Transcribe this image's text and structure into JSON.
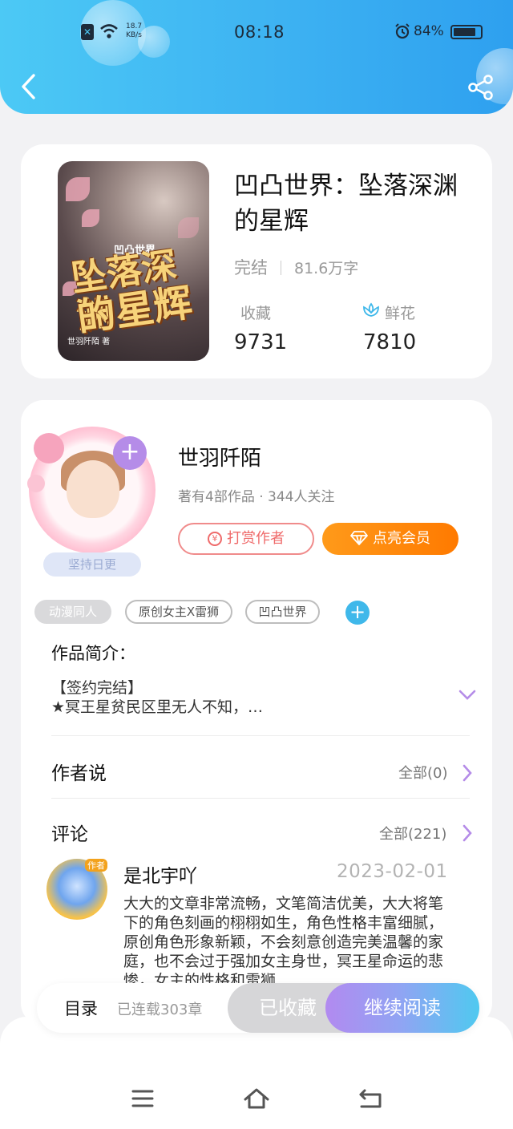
{
  "status_bar": {
    "time": "08:18",
    "speed_value": "18.7",
    "speed_unit": "KB/s",
    "battery": "84%"
  },
  "book": {
    "title": "凹凸世界：坠落深渊的星辉",
    "cover_series": "凹凸世界",
    "cover_title_line1": "坠落深渊",
    "cover_title_line2": "的星辉",
    "cover_author": "世羽阡陌 著",
    "status": "完结",
    "word_count": "81.6万字",
    "favorites_label": "收藏",
    "favorites_count": "9731",
    "flowers_label": "鲜花",
    "flowers_count": "7810"
  },
  "author": {
    "name": "世羽阡陌",
    "meta": "著有4部作品 · 344人关注",
    "reward_label": "打赏作者",
    "vip_label": "点亮会员",
    "badge": "坚持日更",
    "follow_symbol": "+"
  },
  "tags": [
    "动漫同人",
    "原创女主X雷狮",
    "凹凸世界"
  ],
  "intro": {
    "heading": "作品简介：",
    "line1": "【签约完结】",
    "line2": "★冥王星贫民区里无人不知，…"
  },
  "author_says": {
    "heading": "作者说",
    "more": "全部(0)"
  },
  "comments": {
    "heading": "评论",
    "more": "全部(221)",
    "items": [
      {
        "user": "是北宇吖",
        "badge": "作者",
        "date": "2023-02-01",
        "text": "大大的文章非常流畅，文笔简洁优美，大大将笔下的角色刻画的栩栩如生，角色性格丰富细腻，原创角色形象新颖，不会刻意创造完美温馨的家庭，也不会过于强加女主身世，冥王星命运的悲惨，女主的性格和雷狮"
      }
    ]
  },
  "action_bar": {
    "toc_label": "目录",
    "toc_count": "已连载303章",
    "collected_label": "已收藏",
    "read_label": "继续阅读"
  },
  "colors": {
    "header_start": "#4cc9f5",
    "header_end": "#2ea0ef",
    "vip_orange": "#ff7a00",
    "accent_purple": "#b58ce8"
  },
  "icons": [
    "back-icon",
    "share-icon",
    "flower-icon",
    "coin-icon",
    "diamond-icon",
    "chevron-down-icon",
    "chevron-right-icon",
    "menu-icon",
    "home-icon",
    "return-icon"
  ]
}
